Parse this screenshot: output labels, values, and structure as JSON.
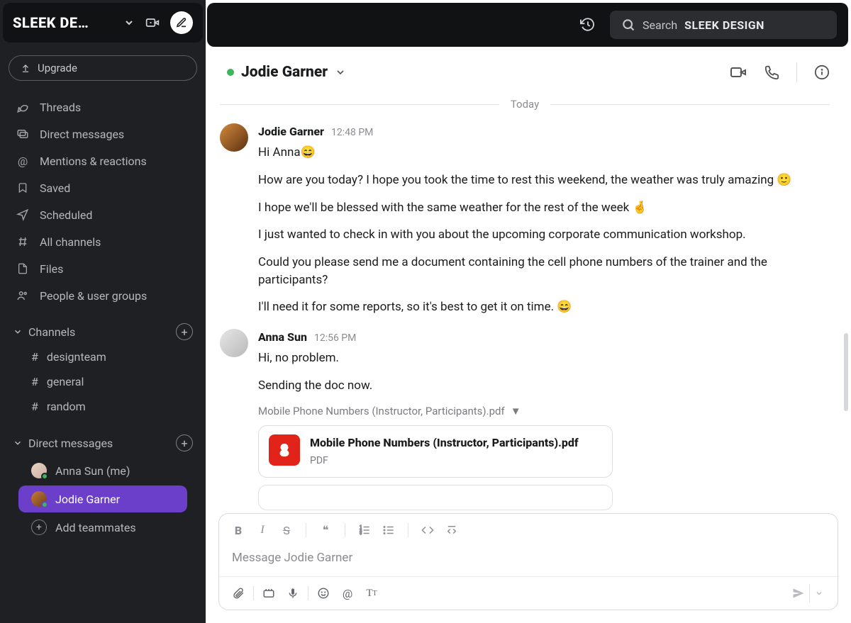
{
  "workspace": {
    "title": "SLEEK DE…"
  },
  "upgrade": {
    "label": "Upgrade"
  },
  "nav": [
    {
      "icon": "threads-icon",
      "label": "Threads"
    },
    {
      "icon": "dm-icon",
      "label": "Direct messages"
    },
    {
      "icon": "mentions-icon",
      "label": "Mentions & reactions"
    },
    {
      "icon": "bookmark-icon",
      "label": "Saved"
    },
    {
      "icon": "scheduled-icon",
      "label": "Scheduled"
    },
    {
      "icon": "all-channels-icon",
      "label": "All channels"
    },
    {
      "icon": "files-icon",
      "label": "Files"
    },
    {
      "icon": "people-icon",
      "label": "People & user groups"
    }
  ],
  "sections": {
    "channels_label": "Channels",
    "dms_label": "Direct messages",
    "channels": [
      {
        "name": "designteam"
      },
      {
        "name": "general"
      },
      {
        "name": "random"
      }
    ],
    "dms": [
      {
        "name": "Anna Sun (me)",
        "active": false
      },
      {
        "name": "Jodie Garner",
        "active": true
      }
    ],
    "add_teammates": "Add teammates"
  },
  "search": {
    "prefix": "Search",
    "bold": "SLEEK DESIGN"
  },
  "chat": {
    "title": "Jodie Garner",
    "divider": "Today",
    "messages": [
      {
        "author": "Jodie Garner",
        "time": "12:48 PM",
        "avatar": "jodie",
        "lines": [
          "Hi Anna😄",
          "How are you today? I hope you took the time to rest this weekend, the weather was truly amazing 🙂",
          "I hope we'll be blessed with the same weather for the rest of the week 🤞",
          "I just wanted to check in with you about the upcoming corporate communication workshop.",
          "Could you please send me a document containing the cell phone numbers of the trainer and the participants?",
          "I'll need it for some reports, so it's best to get it on time. 😄"
        ]
      },
      {
        "author": "Anna Sun",
        "time": "12:56 PM",
        "avatar": "anna",
        "lines": [
          "Hi, no problem.",
          "Sending the doc now."
        ],
        "attachment": {
          "header": "Mobile Phone Numbers (Instructor, Participants).pdf",
          "filename": "Mobile Phone Numbers (Instructor, Participants).pdf",
          "type": "PDF"
        }
      }
    ]
  },
  "composer": {
    "placeholder": "Message Jodie Garner"
  }
}
